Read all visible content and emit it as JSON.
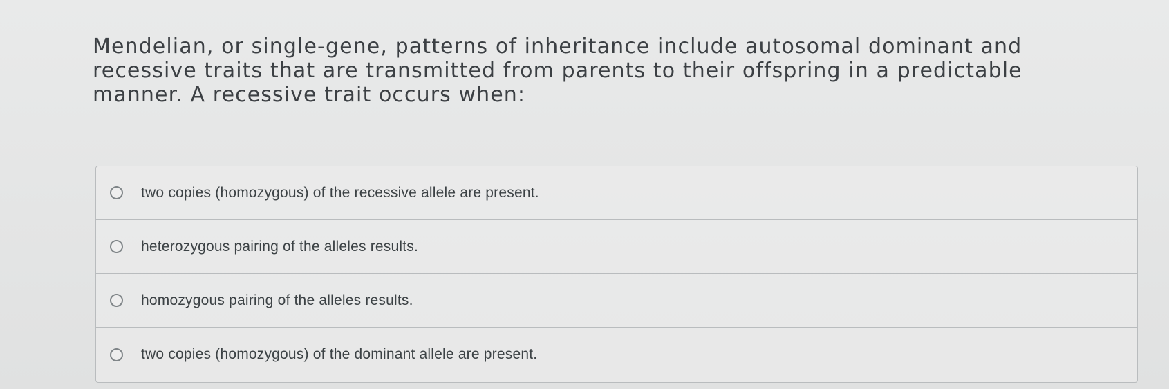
{
  "question": {
    "text": "Mendelian, or single-gene, patterns of inheritance include autosomal dominant and recessive traits that are transmitted from parents to their offspring in a predictable manner. A recessive trait occurs when:"
  },
  "options": [
    {
      "label": "two copies (homozygous) of the recessive allele are present."
    },
    {
      "label": "heterozygous pairing of the alleles results."
    },
    {
      "label": "homozygous pairing of the alleles results."
    },
    {
      "label": "two copies (homozygous) of the dominant allele are present."
    }
  ]
}
